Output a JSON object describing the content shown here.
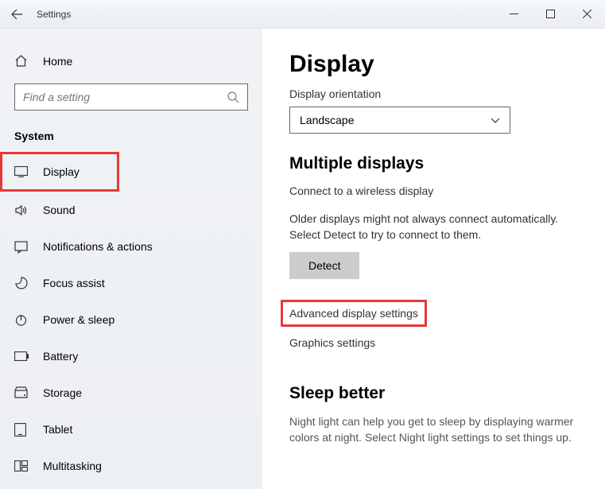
{
  "titlebar": {
    "title": "Settings"
  },
  "sidebar": {
    "home_label": "Home",
    "search_placeholder": "Find a setting",
    "category_title": "System",
    "items": [
      {
        "label": "Display"
      },
      {
        "label": "Sound"
      },
      {
        "label": "Notifications & actions"
      },
      {
        "label": "Focus assist"
      },
      {
        "label": "Power & sleep"
      },
      {
        "label": "Battery"
      },
      {
        "label": "Storage"
      },
      {
        "label": "Tablet"
      },
      {
        "label": "Multitasking"
      }
    ]
  },
  "main": {
    "page_title": "Display",
    "orientation_label": "Display orientation",
    "orientation_value": "Landscape",
    "multiple_displays_title": "Multiple displays",
    "wireless_link": "Connect to a wireless display",
    "detect_desc": "Older displays might not always connect automatically. Select Detect to try to connect to them.",
    "detect_button": "Detect",
    "advanced_link": "Advanced display settings",
    "graphics_link": "Graphics settings",
    "sleep_title": "Sleep better",
    "sleep_desc": "Night light can help you get to sleep by displaying warmer colors at night. Select Night light settings to set things up."
  }
}
